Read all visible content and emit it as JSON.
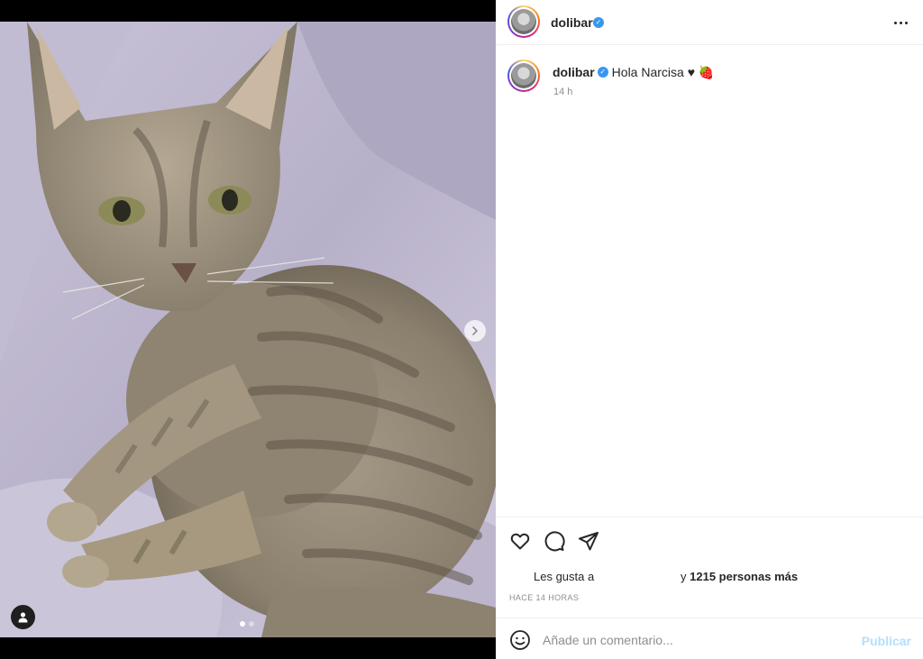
{
  "post": {
    "username": "dolibar",
    "verified_icon": "verified-badge-icon",
    "caption_text": "Hola Narcisa ♥ 🍓",
    "caption_time": "14 h",
    "likes_prefix": "Les gusta a",
    "likes_and": "y",
    "likes_count": "1215 personas más",
    "time_ago": "HACE 14 HORAS"
  },
  "comment": {
    "placeholder": "Añade un comentario...",
    "publish_label": "Publicar"
  },
  "carousel": {
    "total_slides": 2,
    "current_slide": 1
  },
  "colors": {
    "verified": "#3897f0",
    "publish_disabled": "#b2dffc",
    "muted_text": "#8e8e8e",
    "divider": "#efefef"
  }
}
